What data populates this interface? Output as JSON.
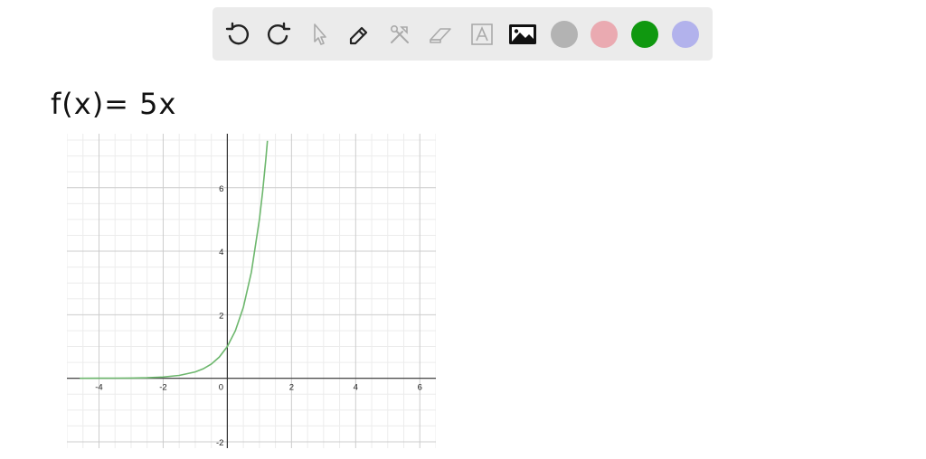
{
  "toolbar": {
    "tools": [
      {
        "name": "undo-icon",
        "enabled": true
      },
      {
        "name": "redo-icon",
        "enabled": true
      },
      {
        "name": "pointer-icon",
        "enabled": false
      },
      {
        "name": "pen-icon",
        "enabled": true
      },
      {
        "name": "tools-icon",
        "enabled": false
      },
      {
        "name": "eraser-icon",
        "enabled": false
      },
      {
        "name": "text-icon",
        "enabled": false
      },
      {
        "name": "image-icon",
        "enabled": true
      }
    ],
    "colors": [
      "#b3b3b3",
      "#eaaab1",
      "#109810",
      "#b2b2ec"
    ],
    "selected_color": "#109810"
  },
  "canvas": {
    "handwritten_text": "f(x)= 5x"
  },
  "chart_data": {
    "type": "line",
    "function": "5^x",
    "series": [
      {
        "color": "#6db76d",
        "x": [
          -4.6,
          -4,
          -3,
          -2.5,
          -2,
          -1.5,
          -1,
          -0.75,
          -0.5,
          -0.25,
          0,
          0.25,
          0.5,
          0.75,
          1,
          1.1,
          1.2,
          1.25
        ],
        "y": [
          0.0006,
          0.0016,
          0.008,
          0.0179,
          0.04,
          0.0894,
          0.2,
          0.299,
          0.447,
          0.669,
          1,
          1.495,
          2.236,
          3.344,
          5,
          5.872,
          6.899,
          7.477
        ]
      }
    ],
    "x_ticks": [
      "-4",
      "-2",
      "0",
      "2",
      "4",
      "6"
    ],
    "y_ticks": [
      "-2",
      "2",
      "4",
      "6"
    ],
    "xlim": [
      -5,
      6.5
    ],
    "ylim": [
      -2.2,
      7.7
    ],
    "grid": true
  }
}
